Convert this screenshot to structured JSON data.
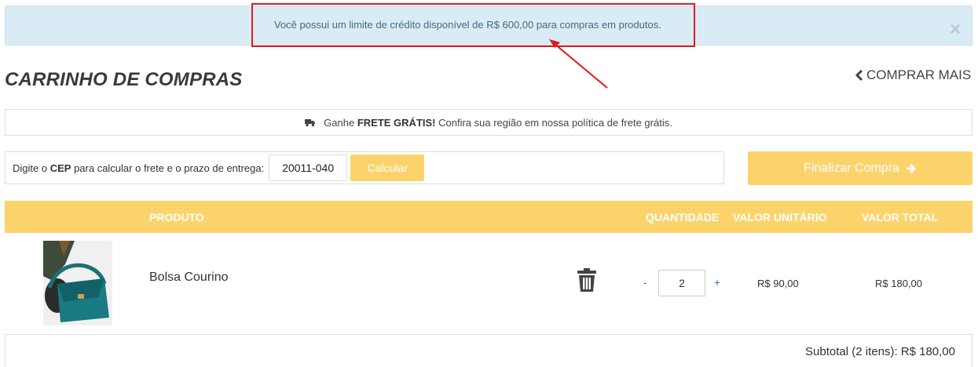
{
  "alert": {
    "message": "Você possui um limite de crédito disponível de R$ 600,00 para compras em produtos.",
    "close_icon": "close-icon",
    "close_glyph": "×"
  },
  "header": {
    "title": "CARRINHO DE COMPRAS",
    "buy_more_label": "COMPRAR MAIS",
    "buy_more_icon": "chevron-left-icon"
  },
  "free_shipping": {
    "icon": "truck-icon",
    "prefix": "Ganhe",
    "highlight": "FRETE GRÁTIS!",
    "suffix": "Confira sua região em nossa política de frete grátis."
  },
  "shipping_calc": {
    "label_prefix": "Digite o",
    "label_bold": "CEP",
    "label_suffix": "para calcular o frete e o prazo de entrega:",
    "cep_value": "20011-040",
    "button_label": "Calcular"
  },
  "checkout": {
    "label": "Finalizar Compra",
    "icon": "arrow-right-icon"
  },
  "table": {
    "headers": {
      "product": "PRODUTO",
      "quantity": "QUANTIDADE",
      "unit_price": "VALOR UNITÁRIO",
      "total_price": "VALOR TOTAL"
    },
    "rows": [
      {
        "name": "Bolsa Courino",
        "quantity": "2",
        "minus": "-",
        "plus": "+",
        "unit_price": "R$ 90,00",
        "total_price": "R$ 180,00",
        "remove_icon": "trash-icon"
      }
    ]
  },
  "subtotal": {
    "text": "Subtotal (2 itens): R$ 180,00"
  },
  "colors": {
    "accent": "#fcd36b",
    "alert_bg": "#d9ecf6",
    "highlight_border": "#e0191b"
  }
}
